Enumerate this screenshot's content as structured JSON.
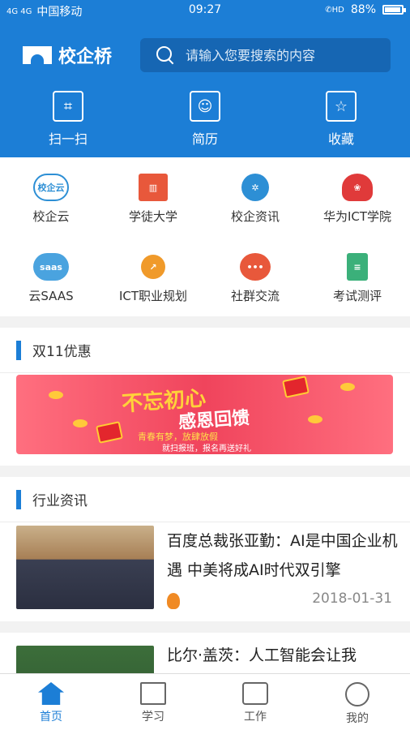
{
  "status_bar": {
    "network": "4G 4G",
    "carrier": "中国移动",
    "time": "09:27",
    "hd": "HD",
    "battery": "88%",
    "battery_level": 0.88
  },
  "header": {
    "app_name": "校企桥",
    "search_placeholder": "请输入您要搜索的内容",
    "quick_actions": [
      {
        "label": "扫一扫",
        "icon": "scan-icon"
      },
      {
        "label": "简历",
        "icon": "resume-icon"
      },
      {
        "label": "收藏",
        "icon": "favorite-icon"
      }
    ]
  },
  "grid": [
    {
      "label": "校企云",
      "icon": "cloud-icon",
      "icon_text": "校企云"
    },
    {
      "label": "学徒大学",
      "icon": "university-icon"
    },
    {
      "label": "校企资讯",
      "icon": "aperture-icon"
    },
    {
      "label": "华为ICT学院",
      "icon": "huawei-icon"
    },
    {
      "label": "云SAAS",
      "icon": "saas-cloud-icon",
      "icon_text": "saas"
    },
    {
      "label": "ICT职业规划",
      "icon": "trend-icon"
    },
    {
      "label": "社群交流",
      "icon": "chat-icon"
    },
    {
      "label": "考试测评",
      "icon": "clipboard-icon"
    }
  ],
  "promo": {
    "title": "双11优惠",
    "banner_line1": "不忘初心",
    "banner_line2": "感恩回馈",
    "banner_line3": "青春有梦，放肆放假",
    "banner_line4": "就扫报班，报名再送好礼"
  },
  "news": {
    "title": "行业资讯",
    "items": [
      {
        "title": "百度总裁张亚勤：AI是中国企业机遇 中美将成AI时代双引擎",
        "date": "2018-01-31",
        "hot": true
      },
      {
        "title": "比尔·盖茨：人工智能会让我"
      }
    ]
  },
  "tabbar": [
    {
      "label": "首页",
      "icon": "home-icon",
      "active": true
    },
    {
      "label": "学习",
      "icon": "book-icon"
    },
    {
      "label": "工作",
      "icon": "briefcase-icon"
    },
    {
      "label": "我的",
      "icon": "user-icon"
    }
  ],
  "colors": {
    "primary": "#1c7ed6",
    "background": "#f2f2f2"
  }
}
